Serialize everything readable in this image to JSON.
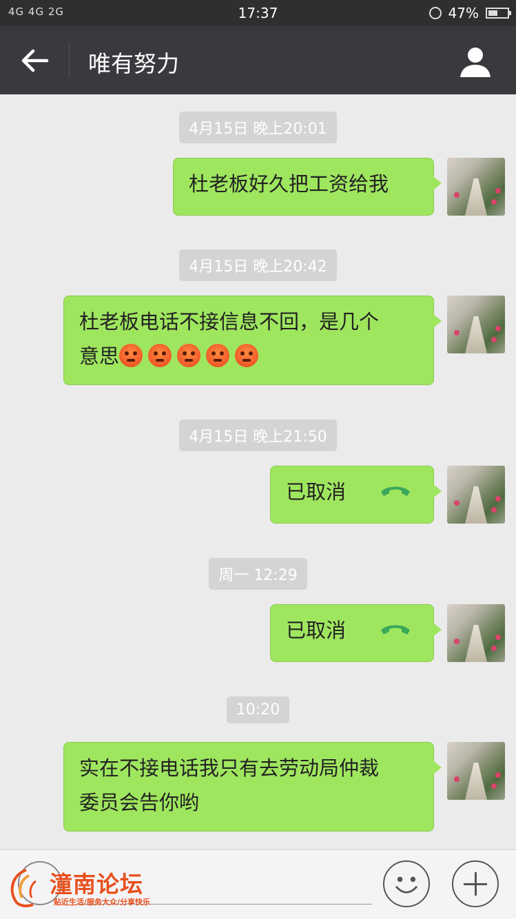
{
  "status_bar": {
    "network": "4G 4G 2G",
    "time": "17:37",
    "battery": "47%"
  },
  "header": {
    "title": "唯有努力"
  },
  "messages": [
    {
      "timestamp": "4月15日 晚上20:01",
      "text": "杜老板好久把工资给我",
      "type": "text"
    },
    {
      "timestamp": "4月15日 晚上20:42",
      "text_line1": "杜老板电话不接信息不回，是几个",
      "text_line2": "意思",
      "emoji_count": 5,
      "type": "text"
    },
    {
      "timestamp": "4月15日 晚上21:50",
      "text": "已取消",
      "type": "call"
    },
    {
      "timestamp": "周一 12:29",
      "text": "已取消",
      "type": "call"
    },
    {
      "timestamp": "10:20",
      "text_line1": "实在不接电话我只有去劳动局仲裁",
      "text_line2": "委员会告你哟",
      "type": "text"
    }
  ],
  "watermark": {
    "name": "潼南论坛",
    "slogan": "贴近生活/服务大众/分享快乐"
  },
  "colors": {
    "bubble": "#9fe65f",
    "titlebar": "#393a3e",
    "background": "#ebebeb"
  }
}
